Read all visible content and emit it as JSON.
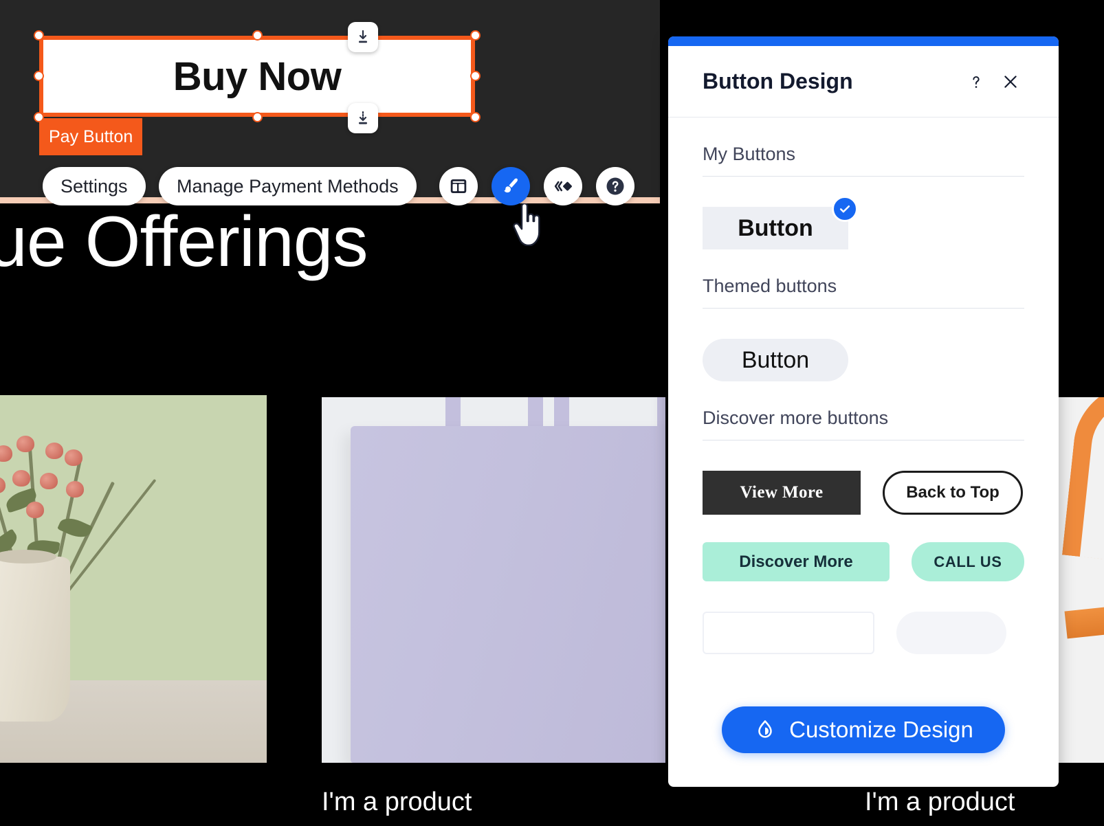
{
  "site": {
    "hero_heading": "ue Offerings",
    "product_captions": [
      "I'm a product",
      "I'm a product"
    ]
  },
  "selection": {
    "element_label": "Buy Now",
    "type_tag": "Pay Button",
    "handle_icon_top": "download-align-icon",
    "handle_icon_bottom": "download-align-icon",
    "accent_color": "#f4591b"
  },
  "toolbar": {
    "items": [
      {
        "label": "Settings",
        "icon": "",
        "kind": "pill"
      },
      {
        "label": "Manage Payment Methods",
        "icon": "",
        "kind": "pill"
      },
      {
        "label": "",
        "icon": "layout-icon",
        "kind": "circle"
      },
      {
        "label": "",
        "icon": "paintbrush-icon",
        "kind": "circle-active"
      },
      {
        "label": "",
        "icon": "animation-icon",
        "kind": "circle"
      },
      {
        "label": "",
        "icon": "help-icon",
        "kind": "circle"
      }
    ],
    "cursor": "pointing-hand-cursor"
  },
  "panel": {
    "title": "Button Design",
    "help_icon": "question-mark-icon",
    "close_icon": "close-icon",
    "accent_color": "#1667f2",
    "sections": [
      {
        "label": "My Buttons",
        "buttons": [
          {
            "label": "Button",
            "style": "square-gray-bold",
            "selected": true,
            "check_icon": "check-icon"
          }
        ]
      },
      {
        "label": "Themed buttons",
        "buttons": [
          {
            "label": "Button",
            "style": "pill-gray",
            "selected": false
          }
        ]
      },
      {
        "label": "Discover more buttons",
        "buttons": [
          {
            "label": "View More",
            "style": "dark-serif"
          },
          {
            "label": "Back to Top",
            "style": "outline-pill"
          },
          {
            "label": "Discover More",
            "style": "mint-rounded"
          },
          {
            "label": "CALL US",
            "style": "mint-pill"
          }
        ]
      }
    ],
    "cta": {
      "label": "Customize Design",
      "icon": "droplet-icon"
    }
  }
}
